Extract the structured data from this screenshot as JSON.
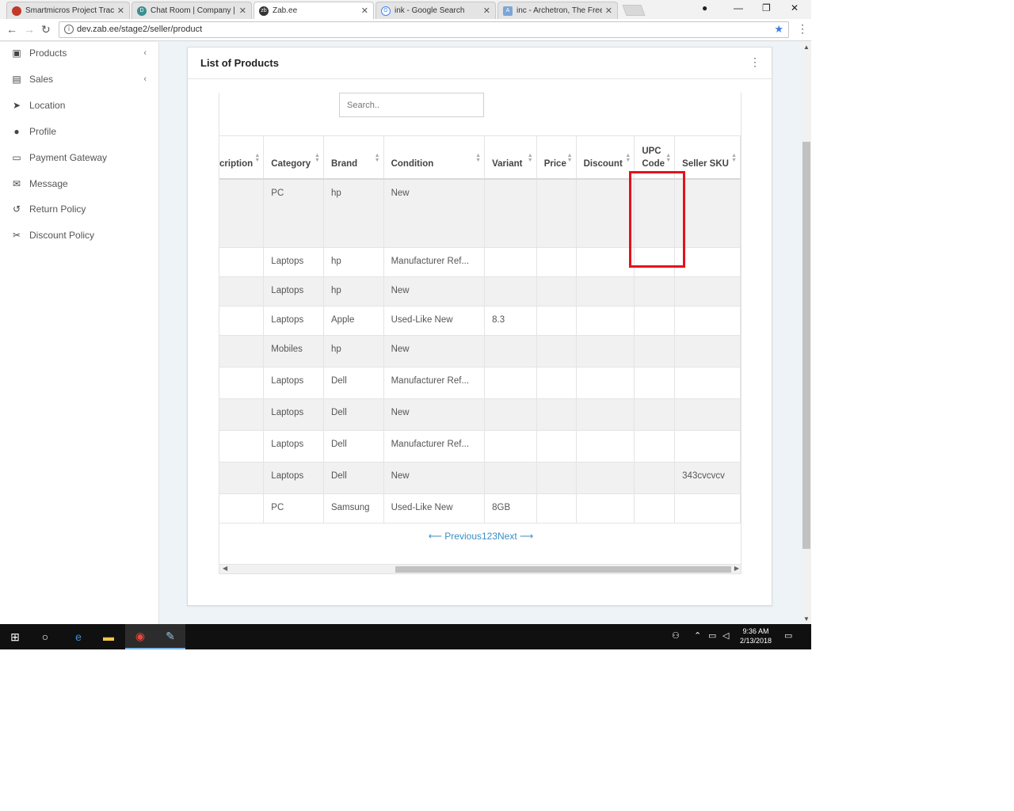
{
  "browser": {
    "tabs": [
      {
        "title": "Smartmicros Project Trac",
        "icon": "redmine-icon",
        "color": "#c0392b",
        "active": false
      },
      {
        "title": "Chat Room | Company |",
        "icon": "chat-icon",
        "color": "#3a8f8f",
        "active": false
      },
      {
        "title": "Zab.ee",
        "icon": "zabee-icon",
        "color": "#333333",
        "active": true
      },
      {
        "title": "ink - Google Search",
        "icon": "google-icon",
        "color": "#4285f4",
        "active": false
      },
      {
        "title": "inc - Archetron, The Free",
        "icon": "a-icon",
        "color": "#7aa6d6",
        "active": false
      }
    ],
    "url": "dev.zab.ee/stage2/seller/product"
  },
  "sidebar": {
    "items": [
      {
        "label": "Products",
        "icon": "briefcase-icon",
        "glyph": "▣",
        "caret": "‹"
      },
      {
        "label": "Sales",
        "icon": "money-icon",
        "glyph": "▤",
        "caret": "‹"
      },
      {
        "label": "Location",
        "icon": "location-arrow-icon",
        "glyph": "➤",
        "caret": ""
      },
      {
        "label": "Profile",
        "icon": "user-icon",
        "glyph": "●",
        "caret": ""
      },
      {
        "label": "Payment Gateway",
        "icon": "credit-card-icon",
        "glyph": "▭",
        "caret": ""
      },
      {
        "label": "Message",
        "icon": "envelope-icon",
        "glyph": "✉",
        "caret": ""
      },
      {
        "label": "Return Policy",
        "icon": "undo-icon",
        "glyph": "↺",
        "caret": ""
      },
      {
        "label": "Discount Policy",
        "icon": "scissors-icon",
        "glyph": "✂",
        "caret": ""
      }
    ]
  },
  "card": {
    "title": "List of Products",
    "search_placeholder": "Search.."
  },
  "table": {
    "columns": [
      "cription",
      "Category",
      "Brand",
      "Condition",
      "Variant",
      "Price",
      "Discount",
      "UPC Code",
      "Seller SKU"
    ],
    "rows": [
      [
        "",
        "PC",
        "hp",
        "New",
        "",
        "",
        "",
        "",
        ""
      ],
      [
        "",
        "Laptops",
        "hp",
        "Manufacturer Ref...",
        "",
        "",
        "",
        "",
        ""
      ],
      [
        "",
        "Laptops",
        "hp",
        "New",
        "",
        "",
        "",
        "",
        ""
      ],
      [
        "",
        "Laptops",
        "Apple",
        "Used-Like New",
        "8.3",
        "",
        "",
        "",
        ""
      ],
      [
        "",
        "Mobiles",
        "hp",
        "New",
        "",
        "",
        "",
        "",
        ""
      ],
      [
        "",
        "Laptops",
        "Dell",
        "Manufacturer Ref...",
        "",
        "",
        "",
        "",
        ""
      ],
      [
        "",
        "Laptops",
        "Dell",
        "New",
        "",
        "",
        "",
        "",
        ""
      ],
      [
        "",
        "Laptops",
        "Dell",
        "Manufacturer Ref...",
        "",
        "",
        "",
        "",
        ""
      ],
      [
        "",
        "Laptops",
        "Dell",
        "New",
        "",
        "",
        "",
        "",
        "343cvcvcv"
      ],
      [
        "",
        "PC",
        "Samsung",
        "Used-Like New",
        "8GB",
        "",
        "",
        "",
        ""
      ]
    ]
  },
  "pagination": {
    "text": "⟵ Previous123Next ⟶"
  },
  "taskbar": {
    "time": "9:36 AM",
    "date": "2/13/2018"
  },
  "colors": {
    "highlight": "#e3121b",
    "link": "#3a8ec5"
  }
}
